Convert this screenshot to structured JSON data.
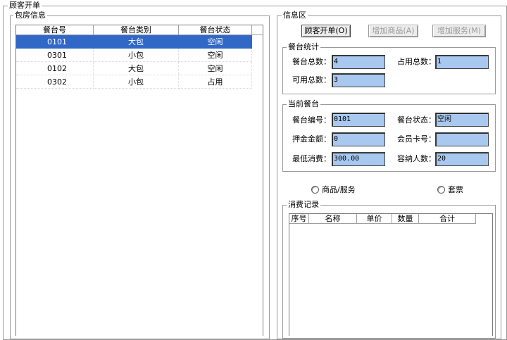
{
  "window": {
    "title": "顾客开单"
  },
  "room_group": {
    "title": "包房信息",
    "columns": [
      "餐台号",
      "餐台类别",
      "餐台状态"
    ],
    "rows": [
      [
        "0101",
        "大包",
        "空闲"
      ],
      [
        "0301",
        "小包",
        "空闲"
      ],
      [
        "0102",
        "大包",
        "空闲"
      ],
      [
        "0302",
        "小包",
        "占用"
      ]
    ]
  },
  "info": {
    "title": "信息区",
    "buttons": {
      "open_order": "顾客开单(O)",
      "add_goods": "增加商品(A)",
      "add_service": "增加服务(M)"
    },
    "stats": {
      "title": "餐台统计",
      "total_label": "餐台总数：",
      "total_value": "4",
      "occupied_label": "占用总数：",
      "occupied_value": "1",
      "available_label": "可用总数：",
      "available_value": "3"
    },
    "current": {
      "title": "当前餐台",
      "number_label": "餐台编号：",
      "number_value": "0101",
      "status_label": "餐台状态：",
      "status_value": "空闲",
      "deposit_label": "押金金额：",
      "deposit_value": "0",
      "member_label": "会员卡号：",
      "member_value": "",
      "min_label": "最低消费：",
      "min_value": "300.00",
      "capacity_label": "容纳人数：",
      "capacity_value": "20"
    },
    "radios": {
      "goods_service": "商品/服务",
      "package": "套票"
    },
    "records": {
      "title": "消费记录",
      "columns": [
        "序号",
        "名称",
        "单价",
        "数量",
        "合计"
      ]
    }
  }
}
